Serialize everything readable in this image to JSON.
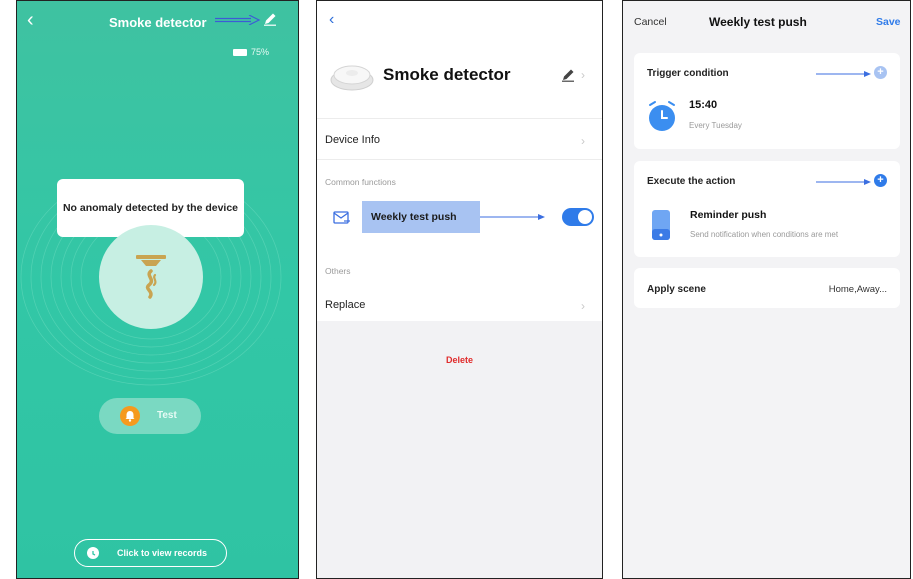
{
  "screen1": {
    "title": "Smoke detector",
    "battery": "75%",
    "status_message": "No anomaly detected by the device",
    "test_label": "Test",
    "records_label": "Click to view records"
  },
  "screen2": {
    "device_name": "Smoke detector",
    "device_info": "Device Info",
    "common_functions": "Common functions",
    "weekly_test": "Weekly test push",
    "weekly_test_enabled": true,
    "others": "Others",
    "replace": "Replace",
    "delete": "Delete"
  },
  "screen3": {
    "cancel": "Cancel",
    "title": "Weekly test push",
    "save": "Save",
    "trigger_title": "Trigger condition",
    "trigger_time": "15:40",
    "trigger_freq": "Every Tuesday",
    "execute_title": "Execute the action",
    "reminder_title": "Reminder push",
    "reminder_sub": "Send notification when conditions are met",
    "apply_scene": "Apply scene",
    "scene_value": "Home,Away..."
  },
  "colors": {
    "teal": "#32c7a6",
    "blue": "#2f7be9",
    "highlight": "#a8c3f2",
    "delete_red": "#e02b2b"
  }
}
